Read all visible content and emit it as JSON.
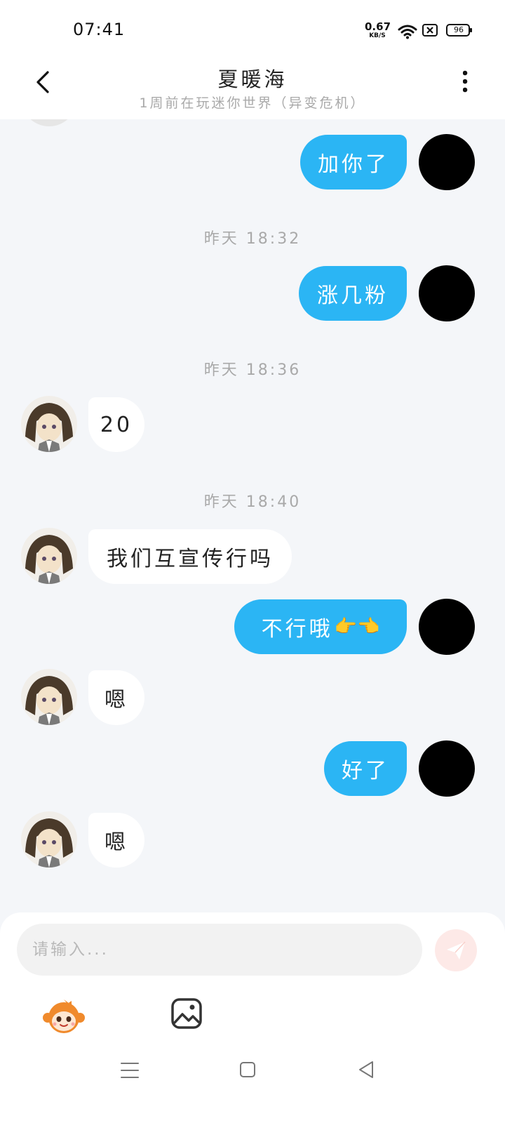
{
  "status_bar": {
    "time": "07:41",
    "net_speed": "0.67",
    "net_unit": "KB/S",
    "battery": "96",
    "icons": [
      "wifi-icon",
      "sim-no-service-icon",
      "battery-icon"
    ]
  },
  "header": {
    "back_icon": "chevron-left-icon",
    "title": "夏暖海",
    "subtitle": "1周前在玩迷你世界（异变危机）",
    "more_icon": "more-vertical-icon"
  },
  "messages": [
    {
      "type": "out",
      "text": "加你了"
    },
    {
      "type": "time",
      "text": "昨天 18:32"
    },
    {
      "type": "out",
      "text": "涨几粉"
    },
    {
      "type": "time",
      "text": "昨天 18:36"
    },
    {
      "type": "in",
      "text": "20"
    },
    {
      "type": "time",
      "text": "昨天 18:40"
    },
    {
      "type": "in",
      "text": "我们互宣传行吗"
    },
    {
      "type": "out",
      "text": "不行哦",
      "emoji": "👉👈"
    },
    {
      "type": "in",
      "text": "嗯"
    },
    {
      "type": "out",
      "text": "好了"
    },
    {
      "type": "in",
      "text": "嗯"
    }
  ],
  "input": {
    "placeholder": "请输入...",
    "send_icon": "paper-plane-icon",
    "toolbar": [
      "sticker-monkey-icon",
      "image-icon"
    ]
  },
  "colors": {
    "outgoing_bubble": "#2bb5f4",
    "incoming_bubble": "#ffffff",
    "chat_background": "#f4f6f9",
    "send_button": "#fde9e7",
    "muted_text": "#a9a9a9"
  },
  "nav_bar": {
    "icons": [
      "menu-icon",
      "home-icon",
      "back-triangle-icon"
    ]
  }
}
